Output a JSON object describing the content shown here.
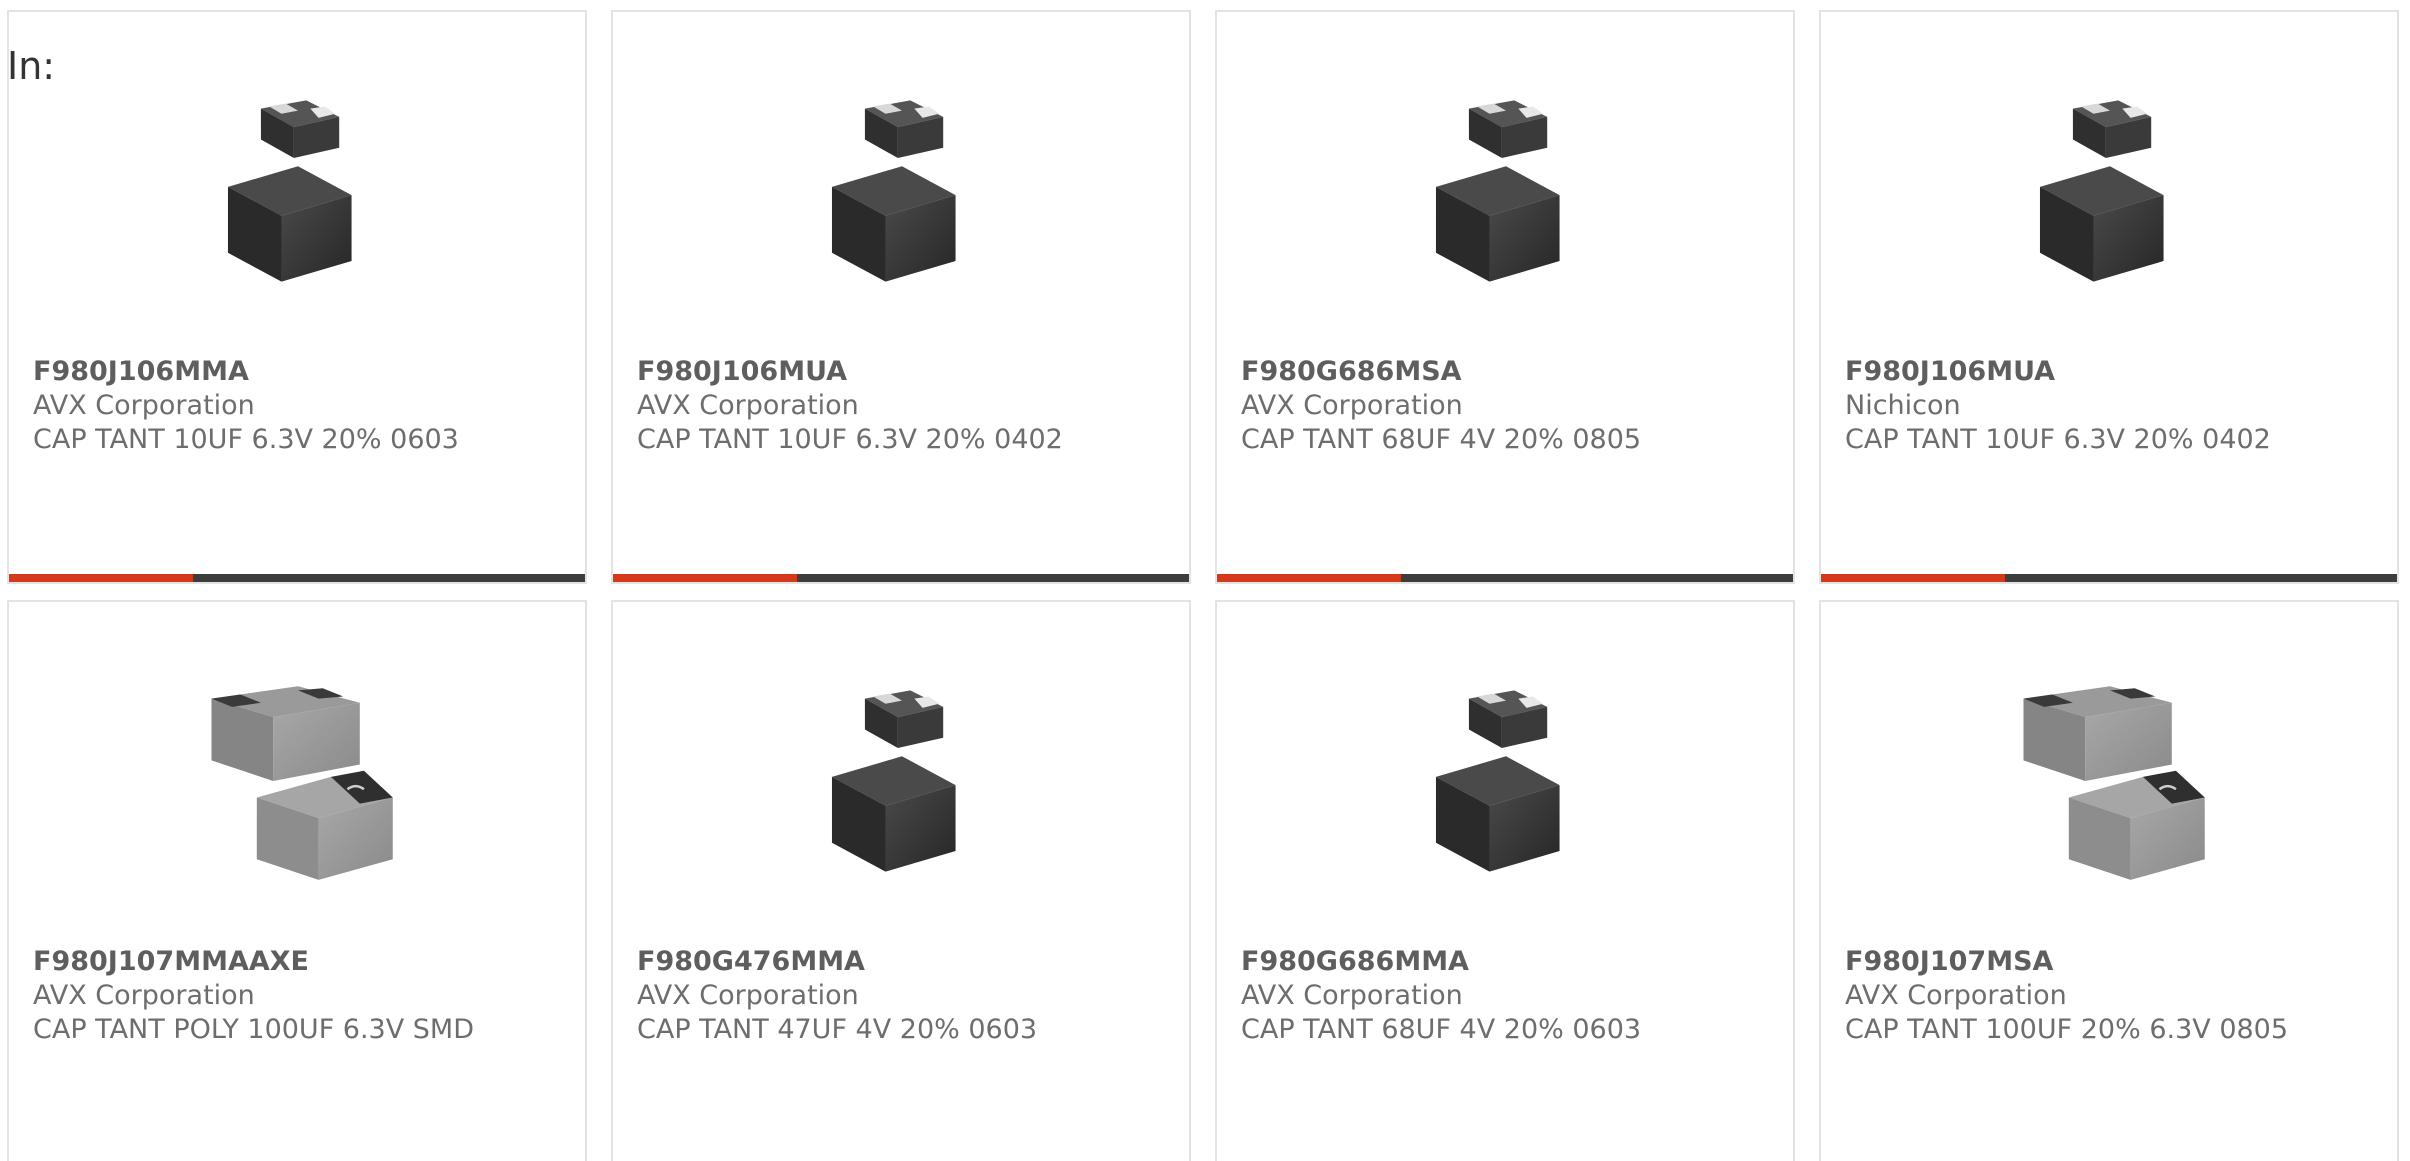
{
  "header": {
    "in_label": "In:"
  },
  "colors": {
    "accent": "#d6381b",
    "bar_track": "#3d3d3d",
    "card_border": "#e3e3e3"
  },
  "products": [
    {
      "part": "F980J106MMA",
      "manufacturer": "AVX Corporation",
      "description": "CAP TANT 10UF 6.3V 20% 0603",
      "image_icon": "dark-smd-capacitor-icon",
      "progress": 0.32,
      "progress_visible": true
    },
    {
      "part": "F980J106MUA",
      "manufacturer": "AVX Corporation",
      "description": "CAP TANT 10UF 6.3V 20% 0402",
      "image_icon": "dark-smd-capacitor-icon",
      "progress": 0.32,
      "progress_visible": true
    },
    {
      "part": "F980G686MSA",
      "manufacturer": "AVX Corporation",
      "description": "CAP TANT 68UF 4V 20% 0805",
      "image_icon": "dark-smd-capacitor-icon",
      "progress": 0.32,
      "progress_visible": true
    },
    {
      "part": "F980J106MUA",
      "manufacturer": "Nichicon",
      "description": "CAP TANT 10UF 6.3V 20% 0402",
      "image_icon": "dark-smd-capacitor-icon",
      "progress": 0.32,
      "progress_visible": true
    },
    {
      "part": "F980J107MMAAXE",
      "manufacturer": "AVX Corporation",
      "description": "CAP TANT POLY 100UF 6.3V SMD",
      "image_icon": "gray-smd-capacitor-icon",
      "progress": 0,
      "progress_visible": false
    },
    {
      "part": "F980G476MMA",
      "manufacturer": "AVX Corporation",
      "description": "CAP TANT 47UF 4V 20% 0603",
      "image_icon": "dark-smd-capacitor-icon",
      "progress": 0,
      "progress_visible": false
    },
    {
      "part": "F980G686MMA",
      "manufacturer": "AVX Corporation",
      "description": "CAP TANT 68UF 4V 20% 0603",
      "image_icon": "dark-smd-capacitor-icon",
      "progress": 0,
      "progress_visible": false
    },
    {
      "part": "F980J107MSA",
      "manufacturer": "AVX Corporation",
      "description": "CAP TANT 100UF 20% 6.3V 0805",
      "image_icon": "gray-smd-capacitor-icon",
      "progress": 0,
      "progress_visible": false
    }
  ]
}
